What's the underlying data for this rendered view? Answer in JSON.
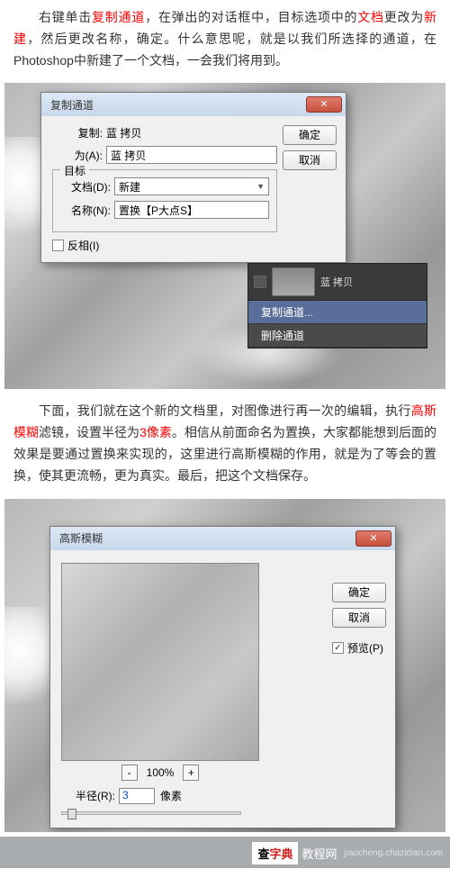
{
  "para1": {
    "t1": "右键单击",
    "r1": "复制通道",
    "t2": "，在弹出的对话框中，目标选项中的",
    "r2": "文档",
    "t3": "更改为",
    "r3": "新建",
    "t4": "，然后更改名称，确定。什么意思呢，就是以我们所选择的通道，在Photoshop中新建了一个文档，一会我们将用到。"
  },
  "dup_dialog": {
    "title": "复制通道",
    "copy_label": "复制:",
    "copy_value": "蓝  拷贝",
    "as_label": "为(A):",
    "as_value": "蓝  拷贝",
    "target_legend": "目标",
    "doc_label": "文档(D):",
    "doc_value": "新建",
    "name_label": "名称(N):",
    "name_value": "置换【P大点S】",
    "invert": "反相(I)",
    "ok": "确定",
    "cancel": "取消"
  },
  "context_menu": {
    "channel_name": "蓝  拷贝",
    "item1": "复制通道...",
    "item2": "删除通道"
  },
  "para2": {
    "t1": "下面，我们就在这个新的文档里，对图像进行再一次的编辑，执行",
    "r1": "高斯模糊",
    "t2": "滤镜，设置半径为",
    "r2": "3像素",
    "t3": "。相信从前面命名为置换，大家都能想到后面的效果是要通过置换来实现的，这里进行高斯模糊的作用，就是为了等会的置换，使其更流畅，更为真实。最后，把这个文档保存。"
  },
  "gblur": {
    "title": "高斯模糊",
    "ok": "确定",
    "cancel": "取消",
    "preview": "预览(P)",
    "zoom_minus": "-",
    "zoom_pct": "100%",
    "zoom_plus": "+",
    "radius_label": "半径(R):",
    "radius_value": "3",
    "radius_unit": "像素"
  },
  "watermark": {
    "brand1": "查",
    "brand2": "字典",
    "suffix": "教程网",
    "url": "jiaocheng.chazidian.com"
  }
}
